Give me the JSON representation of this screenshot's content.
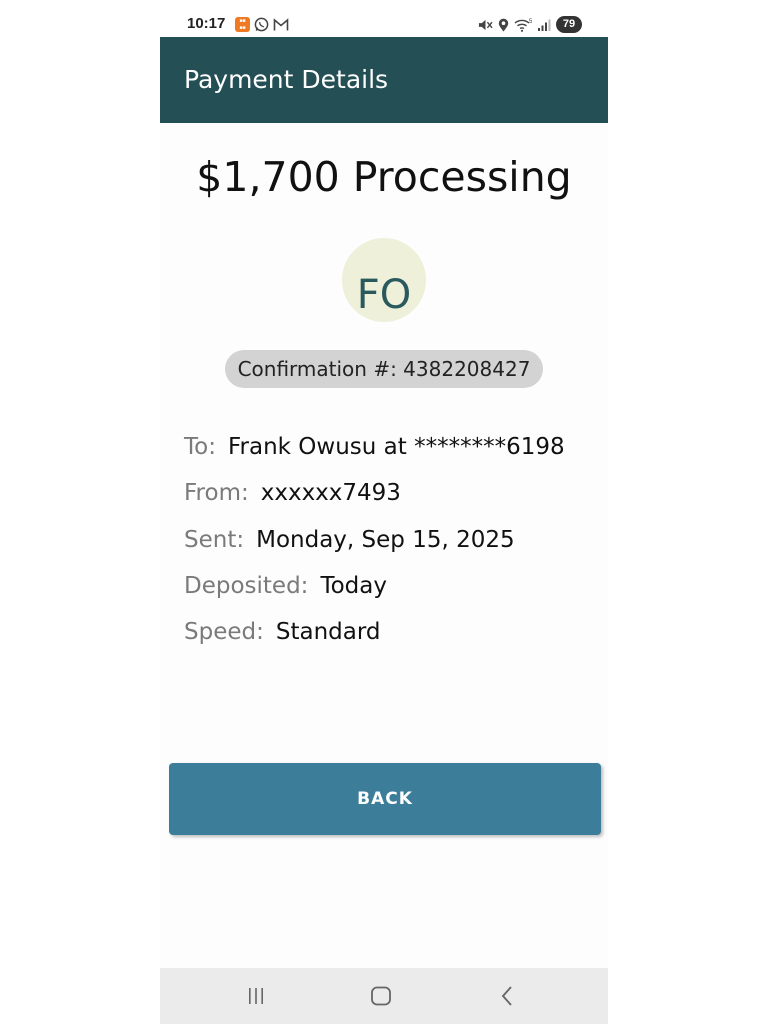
{
  "status_bar": {
    "time": "10:17",
    "battery": "79",
    "left_icons": [
      "app-badge-icon",
      "whatsapp-icon",
      "gmail-icon"
    ],
    "right_icons": [
      "mute-icon",
      "location-icon",
      "wifi-icon",
      "signal-icon",
      "battery-icon"
    ]
  },
  "app_bar": {
    "title": "Payment Details",
    "color": "#245055"
  },
  "payment": {
    "heading": "$1,700 Processing",
    "avatar_initials": "FO",
    "confirmation": "Confirmation #: 4382208427"
  },
  "details": [
    {
      "label": "To:",
      "value": "Frank Owusu at ********6198"
    },
    {
      "label": "From:",
      "value": "xxxxxx7493"
    },
    {
      "label": "Sent:",
      "value": "Monday, Sep 15, 2025"
    },
    {
      "label": "Deposited:",
      "value": "Today"
    },
    {
      "label": "Speed:",
      "value": "Standard"
    }
  ],
  "actions": {
    "back_label": "BACK",
    "button_color": "#3c7d99"
  },
  "nav_bar": {
    "icons": [
      "recent-apps-icon",
      "home-icon",
      "back-nav-icon"
    ]
  }
}
